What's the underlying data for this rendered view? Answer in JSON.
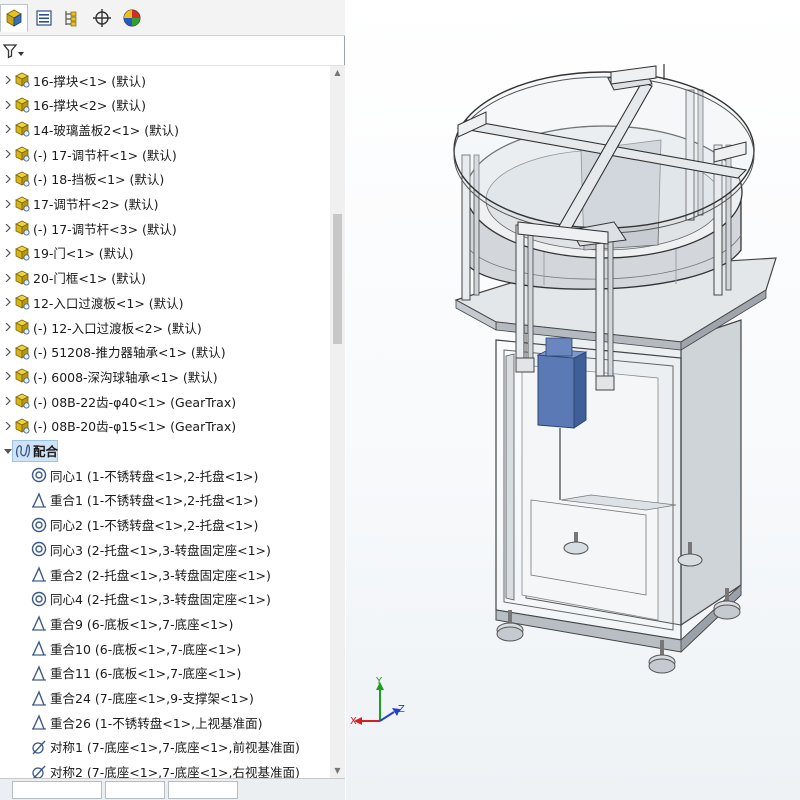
{
  "feature_manager": {
    "tabs": [
      {
        "name": "feature-tree-tab",
        "icon": "feature-manager-icon"
      },
      {
        "name": "property-tab",
        "icon": "property-manager-icon"
      },
      {
        "name": "configuration-tab",
        "icon": "configuration-manager-icon"
      },
      {
        "name": "dimxpert-tab",
        "icon": "dimxpert-icon"
      },
      {
        "name": "display-tab",
        "icon": "display-manager-icon"
      }
    ],
    "filter_icon": "filter-icon"
  },
  "tree": {
    "components": [
      {
        "label": "16-撑块<1> (默认)"
      },
      {
        "label": "16-撑块<2> (默认)"
      },
      {
        "label": "14-玻璃盖板2<1> (默认)"
      },
      {
        "label": "(-) 17-调节杆<1> (默认)"
      },
      {
        "label": "(-) 18-挡板<1> (默认)"
      },
      {
        "label": "17-调节杆<2> (默认)"
      },
      {
        "label": "(-) 17-调节杆<3> (默认)"
      },
      {
        "label": "19-门<1> (默认)"
      },
      {
        "label": "20-门框<1> (默认)"
      },
      {
        "label": "12-入口过渡板<1> (默认)"
      },
      {
        "label": "(-) 12-入口过渡板<2> (默认)"
      },
      {
        "label": "(-) 51208-推力器轴承<1> (默认)"
      },
      {
        "label": "(-) 6008-深沟球轴承<1> (默认)"
      },
      {
        "label": "(-) 08B-22齿-φ40<1> (GearTrax)"
      },
      {
        "label": "(-) 08B-20齿-φ15<1> (GearTrax)"
      }
    ],
    "mates_folder": {
      "label": "配合"
    },
    "mates": [
      {
        "label": "同心1 (1-不锈转盘<1>,2-托盘<1>)",
        "type": "concentric"
      },
      {
        "label": "重合1 (1-不锈转盘<1>,2-托盘<1>)",
        "type": "coincident"
      },
      {
        "label": "同心2 (1-不锈转盘<1>,2-托盘<1>)",
        "type": "concentric"
      },
      {
        "label": "同心3 (2-托盘<1>,3-转盘固定座<1>)",
        "type": "concentric"
      },
      {
        "label": "重合2 (2-托盘<1>,3-转盘固定座<1>)",
        "type": "coincident"
      },
      {
        "label": "同心4 (2-托盘<1>,3-转盘固定座<1>)",
        "type": "concentric"
      },
      {
        "label": "重合9 (6-底板<1>,7-底座<1>)",
        "type": "coincident"
      },
      {
        "label": "重合10 (6-底板<1>,7-底座<1>)",
        "type": "coincident"
      },
      {
        "label": "重合11 (6-底板<1>,7-底座<1>)",
        "type": "coincident"
      },
      {
        "label": "重合24 (7-底座<1>,9-支撑架<1>)",
        "type": "coincident"
      },
      {
        "label": "重合26 (1-不锈转盘<1>,上视基准面)",
        "type": "coincident"
      },
      {
        "label": "对称1 (7-底座<1>,7-底座<1>,前视基准面)",
        "type": "symmetric"
      },
      {
        "label": "对称2 (7-底座<1>,7-底座<1>,右视基准面)",
        "type": "symmetric"
      }
    ]
  },
  "triad": {
    "x_label": "X",
    "y_label": "Y",
    "z_label": "Z",
    "colors": {
      "x": "#d42020",
      "y": "#1e9e1e",
      "z": "#2040d0"
    }
  },
  "colors": {
    "component_yellow": "#e8c21a",
    "mate_blue": "#3b5a8a",
    "selection": "#cfe3f7"
  }
}
